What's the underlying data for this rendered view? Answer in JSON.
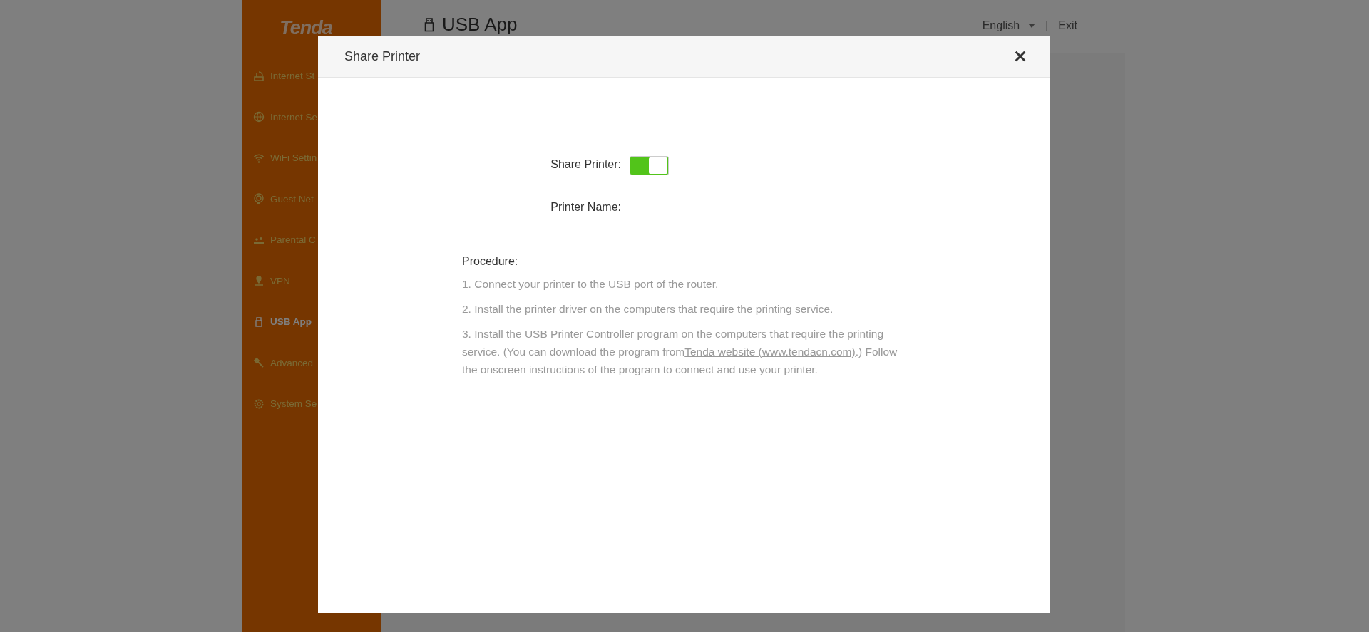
{
  "sidebar": {
    "logo": "Tenda",
    "items": [
      {
        "label": "Internet St",
        "selected": false
      },
      {
        "label": "Internet Se",
        "selected": false
      },
      {
        "label": "WiFi Settin",
        "selected": false
      },
      {
        "label": "Guest Net",
        "selected": false
      },
      {
        "label": "Parental C",
        "selected": false
      },
      {
        "label": "VPN",
        "selected": false
      },
      {
        "label": "USB App",
        "selected": true
      },
      {
        "label": "Advanced",
        "selected": false
      },
      {
        "label": "System Se",
        "selected": false
      }
    ]
  },
  "header": {
    "title": "USB App",
    "language": "English",
    "separator": "|",
    "exit": "Exit"
  },
  "dialog": {
    "title": "Share Printer",
    "share_printer": {
      "label": "Share Printer:",
      "on": true
    },
    "printer_name": {
      "label": "Printer Name:"
    },
    "procedure": {
      "title": "Procedure:",
      "steps": [
        {
          "text": "1. Connect your printer to the USB port of the router."
        },
        {
          "text": "2. Install the printer driver on the computers that require the printing service."
        },
        {
          "text": "3. Install the USB Printer Controller program on the computers that require the printing service. (You can download the program from",
          "link": "Tenda website (www.tendacn.com)",
          "after": ".) Follow the onscreen instructions of the program to connect and use your printer."
        }
      ]
    }
  }
}
